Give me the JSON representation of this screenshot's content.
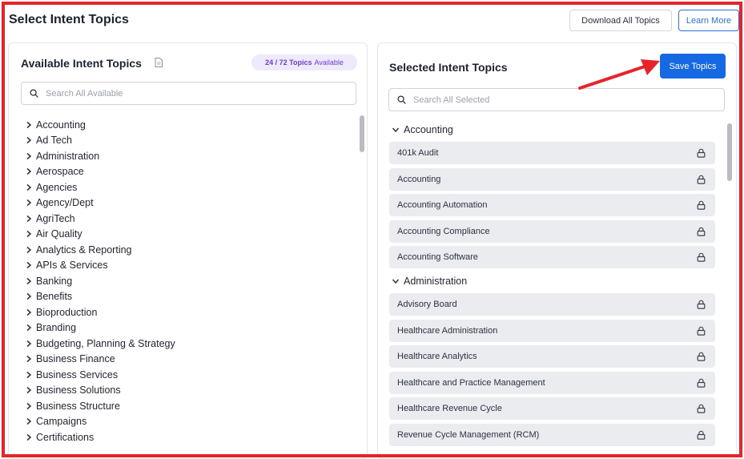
{
  "page": {
    "title": "Select Intent Topics"
  },
  "header": {
    "download_label": "Download All Topics",
    "learn_more_label": "Learn More"
  },
  "available": {
    "title": "Available Intent Topics",
    "badge_count": "24 / 72 Topics",
    "badge_word": "Available",
    "search_placeholder": "Search All Available",
    "items": [
      "Accounting",
      "Ad Tech",
      "Administration",
      "Aerospace",
      "Agencies",
      "Agency/Dept",
      "AgriTech",
      "Air Quality",
      "Analytics & Reporting",
      "APIs & Services",
      "Banking",
      "Benefits",
      "Bioproduction",
      "Branding",
      "Budgeting, Planning & Strategy",
      "Business Finance",
      "Business Services",
      "Business Solutions",
      "Business Structure",
      "Campaigns",
      "Certifications"
    ]
  },
  "selected": {
    "title": "Selected Intent Topics",
    "save_label": "Save Topics",
    "search_placeholder": "Search All Selected",
    "groups": [
      {
        "name": "Accounting",
        "items": [
          "401k Audit",
          "Accounting",
          "Accounting Automation",
          "Accounting Compliance",
          "Accounting Software"
        ]
      },
      {
        "name": "Administration",
        "items": [
          "Advisory Board",
          "Healthcare Administration",
          "Healthcare Analytics",
          "Healthcare and Practice Management",
          "Healthcare Revenue Cycle",
          "Revenue Cycle Management (RCM)"
        ]
      }
    ]
  },
  "icons": {
    "search": "search-icon",
    "lock": "lock-icon",
    "chevron_right": "chevron-right-icon",
    "chevron_down": "chevron-down-icon",
    "document": "document-icon",
    "annotation_arrow": "red-arrow-icon"
  },
  "colors": {
    "accent": "#1668e3",
    "badge_text": "#6b3fd1",
    "badge_bg": "#eee9fb",
    "annotation": "#e4262a",
    "item_bg": "#eaecef"
  }
}
